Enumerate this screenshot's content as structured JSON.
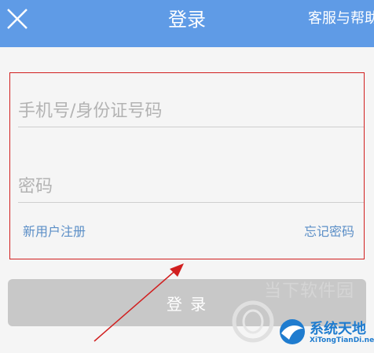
{
  "header": {
    "title": "登录",
    "help_label": "客服与帮助"
  },
  "form": {
    "phone_placeholder": "手机号/身份证号码",
    "password_placeholder": "密码",
    "register_label": "新用户注册",
    "forgot_label": "忘记密码"
  },
  "login_button_label": "登 录",
  "watermark": {
    "text": "当下软件园",
    "brand_cn": "系统天地",
    "brand_en": "XiTongTianDi.net"
  },
  "colors": {
    "header": "#5f9be6",
    "link": "#5c8fc7",
    "highlight_box": "#d11f1f",
    "button": "#c8c8c8"
  }
}
